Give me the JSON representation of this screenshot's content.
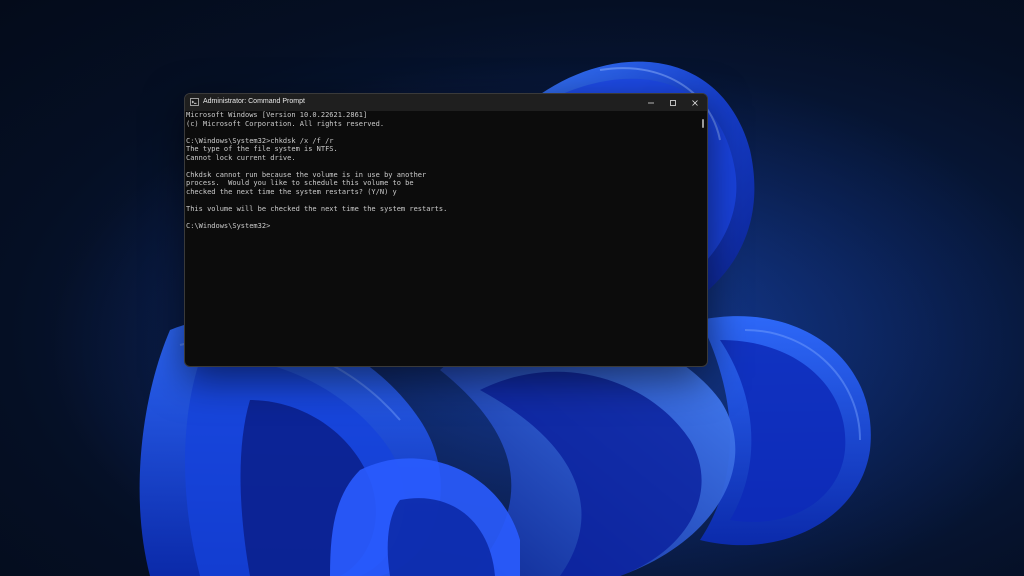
{
  "window": {
    "title": "Administrator: Command Prompt",
    "icon": "cmd-icon"
  },
  "caption_buttons": {
    "minimize": "minimize-icon",
    "maximize": "maximize-icon",
    "close": "close-icon"
  },
  "console": {
    "lines": [
      "Microsoft Windows [Version 10.0.22621.2861]",
      "(c) Microsoft Corporation. All rights reserved.",
      "",
      "C:\\Windows\\System32>chkdsk /x /f /r",
      "The type of the file system is NTFS.",
      "Cannot lock current drive.",
      "",
      "Chkdsk cannot run because the volume is in use by another",
      "process.  Would you like to schedule this volume to be",
      "checked the next time the system restarts? (Y/N) y",
      "",
      "This volume will be checked the next time the system restarts.",
      "",
      "C:\\Windows\\System32>"
    ]
  },
  "colors": {
    "console_background": "#0c0c0c",
    "console_text": "#cccccc",
    "titlebar": "#1f1f1f",
    "wallpaper_accent": "#1f4fff"
  }
}
